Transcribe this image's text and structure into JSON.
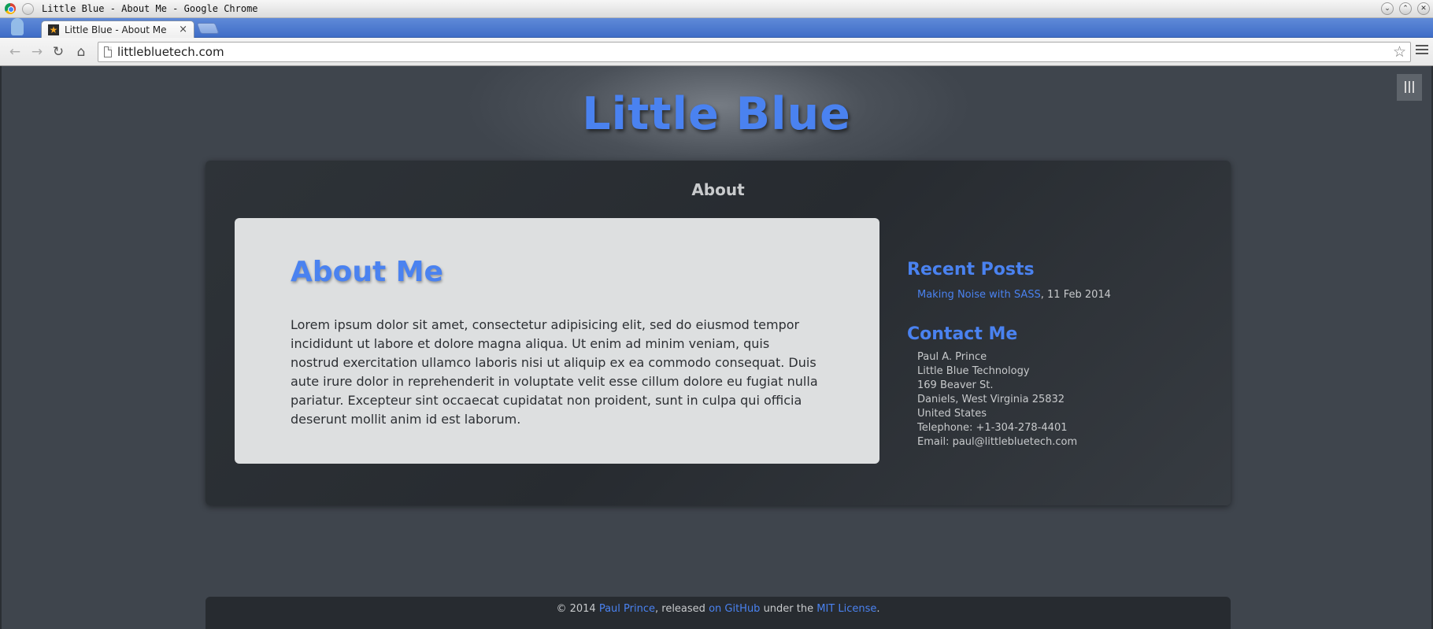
{
  "window": {
    "title": "Little Blue - About Me - Google Chrome"
  },
  "tab": {
    "label": "Little Blue - About Me",
    "close": "×"
  },
  "toolbar": {
    "url": "littlebluetech.com"
  },
  "site": {
    "title": "Little Blue",
    "section": "About"
  },
  "article": {
    "heading": "About Me",
    "body": "Lorem ipsum dolor sit amet, consectetur adipisicing elit, sed do eiusmod tempor incididunt ut labore et dolore magna aliqua. Ut enim ad minim veniam, quis nostrud exercitation ullamco laboris nisi ut aliquip ex ea commodo consequat. Duis aute irure dolor in reprehenderit in voluptate velit esse cillum dolore eu fugiat nulla pariatur. Excepteur sint occaecat cupidatat non proident, sunt in culpa qui officia deserunt mollit anim id est laborum."
  },
  "sidebar": {
    "recent_posts_heading": "Recent Posts",
    "posts": [
      {
        "title": "Making Noise with SASS",
        "date": ", 11 Feb 2014"
      }
    ],
    "contact_heading": "Contact Me",
    "contact_lines": [
      "Paul A. Prince",
      "Little Blue Technology",
      "169 Beaver St.",
      "Daniels, West Virginia 25832",
      "United States",
      "Telephone: +1-304-278-4401",
      "Email: paul@littlebluetech.com"
    ]
  },
  "footer": {
    "prefix": "© 2014 ",
    "author": "Paul Prince",
    "middle": ", released ",
    "github": "on GitHub",
    "under": " under the ",
    "license": "MIT License",
    "end": "."
  },
  "colors": {
    "accent": "#4a82f0",
    "page_bg": "#3f454d",
    "panel_bg": "#2b2f34",
    "article_bg": "#dddfe0",
    "tabstrip": "#4a78cf"
  },
  "icons": {
    "app": "chrome-icon",
    "back": "back-arrow-icon",
    "forward": "forward-arrow-icon",
    "reload": "reload-icon",
    "home": "home-icon",
    "bookmark": "star-icon",
    "menu": "hamburger-menu-icon",
    "site_nav": "sidebar-toggle-icon"
  }
}
